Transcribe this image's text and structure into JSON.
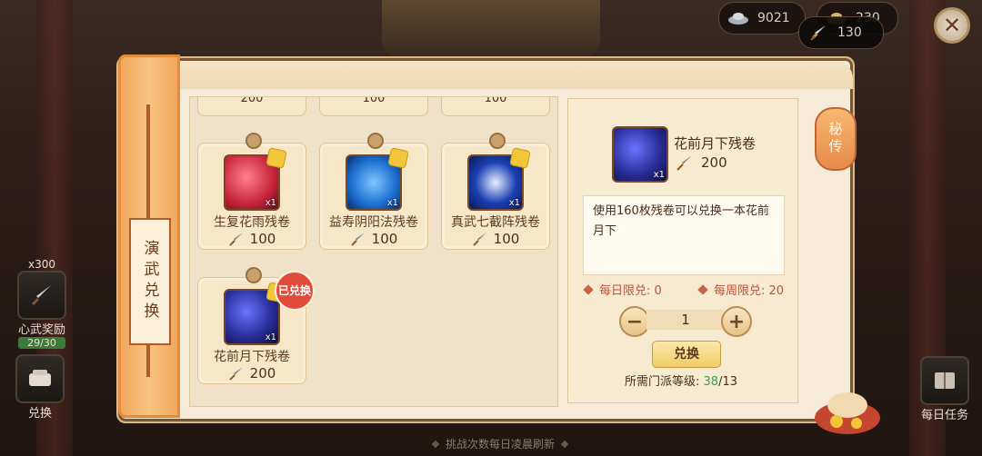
{
  "currency": [
    {
      "icon": "silver-ingot-icon",
      "value": "9021"
    },
    {
      "icon": "gold-ingot-icon",
      "value": "230"
    },
    {
      "icon": "dagger-token-icon",
      "value": "130"
    }
  ],
  "side_tab": {
    "label": "演武兑换"
  },
  "left_widgets": {
    "reward_count": "x300",
    "reward_label": "心武奖励",
    "reward_progress": "29/30",
    "exchange_label": "兑换"
  },
  "right_widget": {
    "label": "每日任务"
  },
  "lantern_label": "秘传",
  "items_top_prices": [
    "200",
    "100",
    "100"
  ],
  "items": [
    {
      "name": "生复花雨残卷",
      "qty": "x1",
      "price": "100",
      "color": "#c8243a"
    },
    {
      "name": "益寿阴阳法残卷",
      "qty": "x1",
      "price": "100",
      "color": "#1d6fd1"
    },
    {
      "name": "真武七截阵残卷",
      "qty": "x1",
      "price": "100",
      "color": "#1a3fb3"
    },
    {
      "name": "花前月下残卷",
      "qty": "x1",
      "price": "200",
      "color": "#2a2f9c",
      "stamp": "已兑换"
    }
  ],
  "detail": {
    "title": "花前月下残卷",
    "qty": "x1",
    "cost": "200",
    "description": "使用160枚残卷可以兑换一本花前月下",
    "daily_limit": "每日限兑: 0",
    "weekly_limit": "每周限兑: 20",
    "quantity": "1",
    "exchange_button": "兑换",
    "requirement_label": "所需门派等级: ",
    "requirement_current": "38",
    "requirement_total": "/13"
  },
  "footer": "挑战次数每日凌晨刷新"
}
